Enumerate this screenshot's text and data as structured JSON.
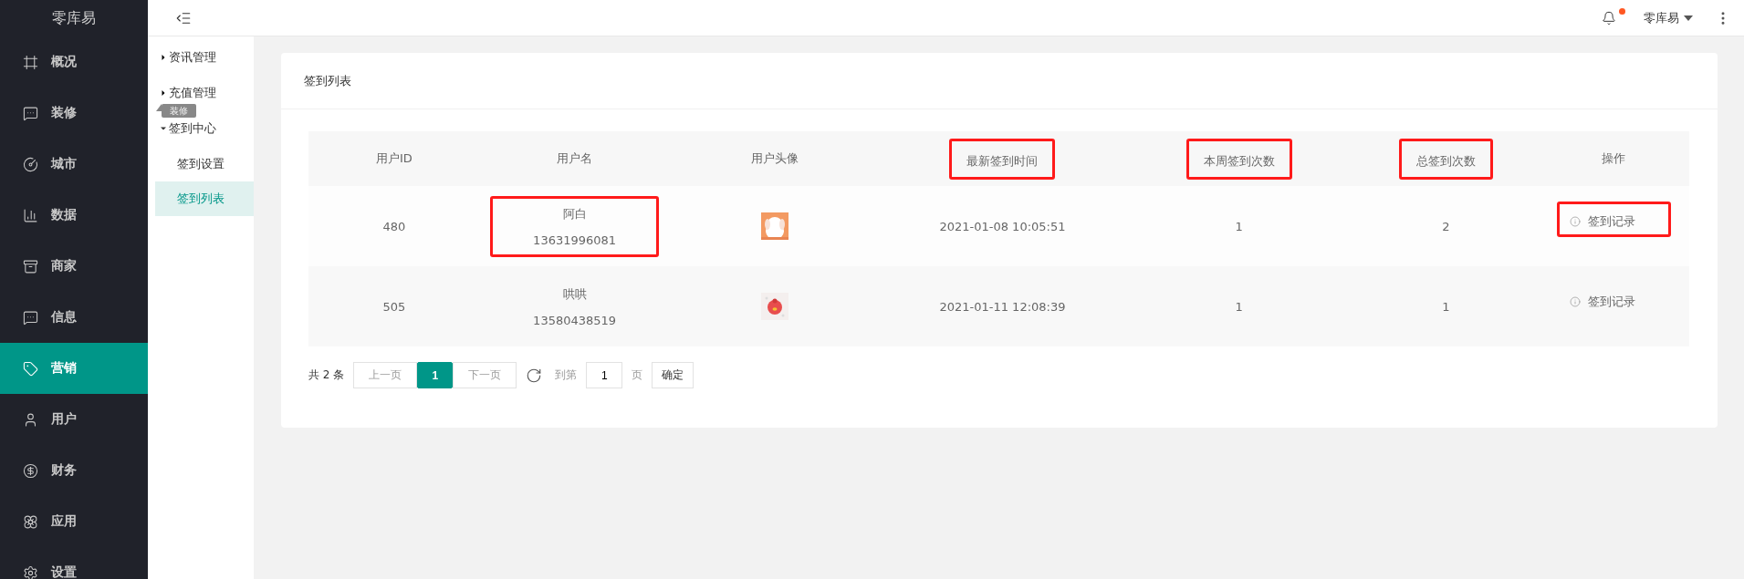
{
  "logo": "零库易",
  "nav": [
    {
      "label": "概况",
      "selected": false
    },
    {
      "label": "装修",
      "selected": false
    },
    {
      "label": "城市",
      "selected": false
    },
    {
      "label": "数据",
      "selected": false
    },
    {
      "label": "商家",
      "selected": false
    },
    {
      "label": "信息",
      "selected": false
    },
    {
      "label": "营销",
      "selected": true
    },
    {
      "label": "用户",
      "selected": false
    },
    {
      "label": "财务",
      "selected": false
    },
    {
      "label": "应用",
      "selected": false
    },
    {
      "label": "设置",
      "selected": false
    }
  ],
  "tooltip": "装修",
  "topbar": {
    "user": "零库易"
  },
  "subnav": [
    {
      "label": "资讯管理",
      "expanded": false
    },
    {
      "label": "充值管理",
      "expanded": false
    },
    {
      "label": "签到中心",
      "expanded": true,
      "children": [
        {
          "label": "签到设置",
          "selected": false
        },
        {
          "label": "签到列表",
          "selected": true
        }
      ]
    }
  ],
  "card": {
    "title": "签到列表"
  },
  "table": {
    "columns": [
      {
        "label": "用户ID",
        "highlighted": false
      },
      {
        "label": "用户名",
        "highlighted": false
      },
      {
        "label": "用户头像",
        "highlighted": false
      },
      {
        "label": "最新签到时间",
        "highlighted": true
      },
      {
        "label": "本周签到次数",
        "highlighted": true
      },
      {
        "label": "总签到次数",
        "highlighted": true
      },
      {
        "label": "操作",
        "highlighted": false
      }
    ],
    "rows": [
      {
        "id": "480",
        "name": "阿白",
        "phone": "13631996081",
        "name_highlighted": true,
        "time": "2021-01-08 10:05:51",
        "week": "1",
        "total": "2",
        "action": "签到记录",
        "action_highlighted": true
      },
      {
        "id": "505",
        "name": "哄哄",
        "phone": "13580438519",
        "name_highlighted": false,
        "time": "2021-01-11 12:08:39",
        "week": "1",
        "total": "1",
        "action": "签到记录",
        "action_highlighted": false
      }
    ]
  },
  "pagination": {
    "total": "共 2 条",
    "prev": {
      "label": "上一页",
      "disabled": true
    },
    "pages": [
      {
        "label": "1",
        "selected": true
      }
    ],
    "next": {
      "label": "下一页",
      "disabled": true
    },
    "goto": "到第",
    "page_value": "1",
    "page_unit": "页",
    "confirm": "确定"
  }
}
